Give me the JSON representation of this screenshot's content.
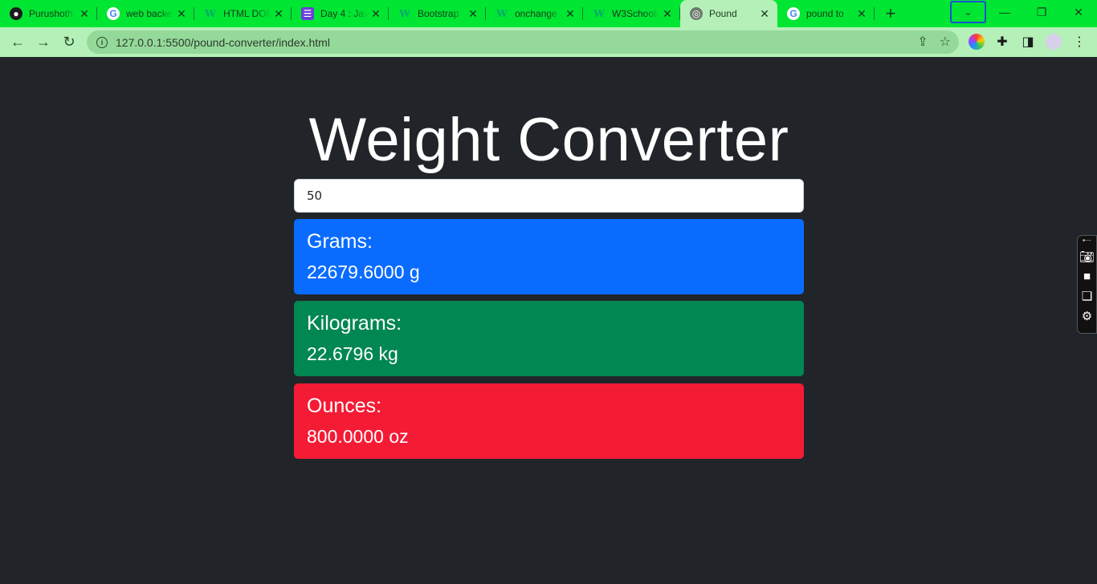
{
  "browser": {
    "tabs": [
      {
        "favicon": "github-icon",
        "title": "Purushoth",
        "active": false
      },
      {
        "favicon": "google-icon",
        "title": "web backe",
        "active": false
      },
      {
        "favicon": "w3schools-icon",
        "title": "HTML DOM",
        "active": false
      },
      {
        "favicon": "doc-icon",
        "title": "Day 4 : Java",
        "active": false
      },
      {
        "favicon": "w3schools-icon",
        "title": "Bootstrap",
        "active": false
      },
      {
        "favicon": "w3schools-icon",
        "title": "onchange",
        "active": false
      },
      {
        "favicon": "w3schools-icon",
        "title": "W3Schools",
        "active": false
      },
      {
        "favicon": "globe-icon",
        "title": "Pound",
        "active": true
      },
      {
        "favicon": "google-icon",
        "title": "pound to",
        "active": false
      }
    ],
    "url": "127.0.0.1:5500/pound-converter/index.html",
    "colors": {
      "tabbar": "#00e632",
      "toolbar": "#b5f0b8",
      "omnibox": "#95d99a"
    }
  },
  "page": {
    "heading": "Weight Converter",
    "input_value": "50",
    "cards": [
      {
        "label": "Grams:",
        "value": "22679.6000 g",
        "color": "#0a6cff"
      },
      {
        "label": "Kilograms:",
        "value": "22.6796 kg",
        "color": "#018752"
      },
      {
        "label": "Ounces:",
        "value": "800.0000 oz",
        "color": "#f41b35"
      }
    ],
    "background": "#212529"
  }
}
